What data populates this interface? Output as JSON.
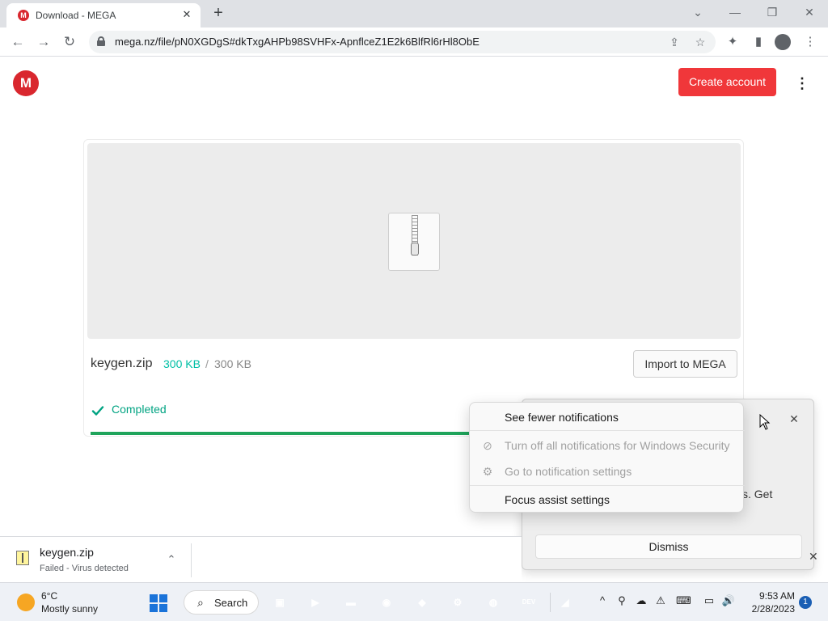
{
  "browser": {
    "tab": {
      "title": "Download - MEGA",
      "favicon_letter": "M",
      "close": "✕"
    },
    "new_tab": "+",
    "window_controls": {
      "dropdown": "⌄",
      "minimize": "—",
      "restore": "❐",
      "close": "✕"
    },
    "nav": {
      "back": "←",
      "forward": "→",
      "reload": "↻"
    },
    "url": "mega.nz/file/pN0XGDgS#dkTxgAHPb98SVHFx-ApnflceZ1E2k6BlfRl6rHl8ObE",
    "icons": {
      "share": "⇪",
      "bookmark": "☆",
      "extensions": "✦",
      "side_panel": "▮",
      "menu": "⋮"
    }
  },
  "mega": {
    "logo_letter": "M",
    "create_account": "Create account",
    "more": "⋮",
    "file": {
      "name": "keygen.zip",
      "downloaded": "300 KB",
      "separator": "/",
      "total": "300 KB",
      "import_label": "Import to MEGA",
      "status": "Completed",
      "progress": 1.0
    }
  },
  "notification": {
    "menu_items": [
      {
        "label": "See fewer notifications",
        "enabled": true
      },
      {
        "label": "Turn off all notifications for Windows Security",
        "enabled": false,
        "icon": "⊘"
      },
      {
        "label": "Go to notification settings",
        "enabled": false,
        "icon": "⚙"
      },
      {
        "label": "Focus assist settings",
        "enabled": true
      }
    ],
    "body_fragment": "s. Get",
    "dismiss": "Dismiss",
    "close": "✕"
  },
  "download_shelf": {
    "file_name": "keygen.zip",
    "status": "Failed - Virus detected",
    "chevron": "⌃",
    "edge_close": "✕"
  },
  "taskbar": {
    "weather": {
      "temp": "6°C",
      "desc": "Mostly sunny"
    },
    "search_label": "Search",
    "search_icon": "⌕",
    "apps": [
      {
        "name": "task-view",
        "glyph": "▣",
        "color": "#333333"
      },
      {
        "name": "teams",
        "glyph": "▶",
        "color": "#5b5fc7"
      },
      {
        "name": "file-explorer",
        "glyph": "▬",
        "color": "#f2b619"
      },
      {
        "name": "chrome",
        "glyph": "◉",
        "color": "#db4437"
      },
      {
        "name": "visual-studio",
        "glyph": "◆",
        "color": "#7b4fbf"
      },
      {
        "name": "settings",
        "glyph": "⚙",
        "color": "#5f6b7a"
      },
      {
        "name": "steam",
        "glyph": "◍",
        "color": "#1b2838"
      },
      {
        "name": "dev-cpp",
        "glyph": "DEV",
        "color": "#c62828"
      },
      {
        "name": "wireshark",
        "glyph": "◢",
        "color": "#3a88c8"
      }
    ],
    "tray": {
      "chevron": "^",
      "search": "⚲",
      "onedrive": "☁",
      "security": "⚠",
      "keyboard": "⌨",
      "display": "▭",
      "volume": "🔊"
    },
    "time": "9:53 AM",
    "date": "2/28/2023",
    "notif_count": "1"
  }
}
